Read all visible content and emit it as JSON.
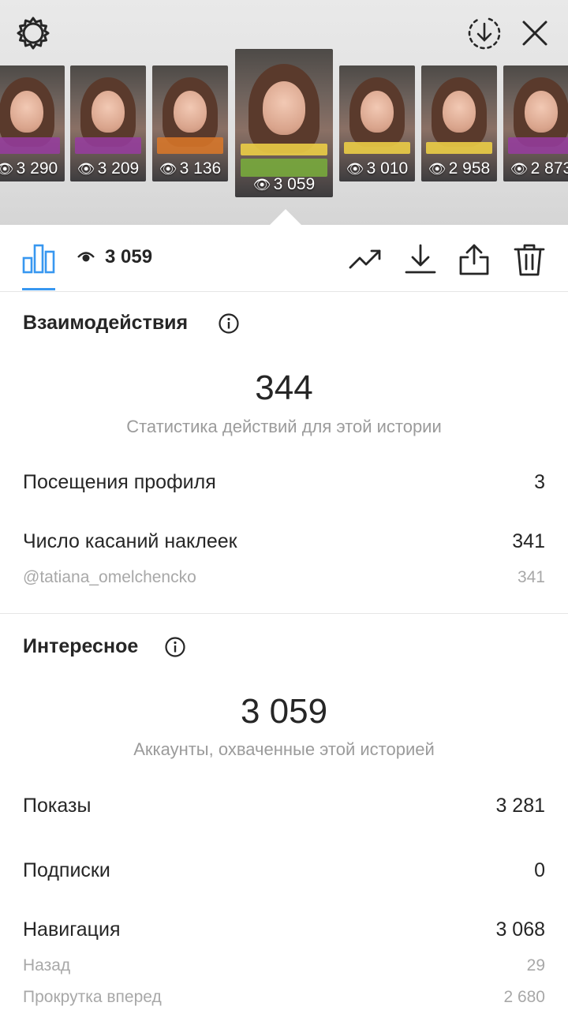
{
  "header": {
    "settings_icon": "gear-icon",
    "download_icon": "download-circle-icon",
    "close_icon": "close-icon"
  },
  "stories": [
    {
      "views": "3 290",
      "caption": "purple"
    },
    {
      "views": "3 209",
      "caption": "purple"
    },
    {
      "views": "3 136",
      "caption": "orange"
    },
    {
      "views": "3 059",
      "caption": "green",
      "selected": true,
      "tag": "@TATIANA_OMELCHENCKO"
    },
    {
      "views": "3 010",
      "caption": "yellow"
    },
    {
      "views": "2 958",
      "caption": "yellow"
    },
    {
      "views": "2 873",
      "caption": "purple"
    }
  ],
  "toolbar": {
    "views": "3 059",
    "icons": [
      "bar-chart-icon",
      "eye-icon",
      "trending-icon",
      "download-icon",
      "share-icon",
      "trash-icon"
    ],
    "accent": "#3897f0"
  },
  "interactions": {
    "title": "Взаимодействия",
    "total": "344",
    "subtitle": "Статистика действий для этой истории",
    "rows": [
      {
        "label": "Посещения профиля",
        "value": "3"
      },
      {
        "label": "Число касаний наклеек",
        "value": "341"
      },
      {
        "label": "@tatiana_omelchencko",
        "value": "341",
        "muted": true
      }
    ]
  },
  "discovery": {
    "title": "Интересное",
    "total": "3 059",
    "subtitle": "Аккаунты, охваченные этой историей",
    "rows": [
      {
        "label": "Показы",
        "value": "3 281"
      },
      {
        "label": "Подписки",
        "value": "0"
      },
      {
        "label": "Навигация",
        "value": "3 068"
      },
      {
        "label": "Назад",
        "value": "29",
        "muted": true
      },
      {
        "label": "Прокрутка вперед",
        "value": "2 680",
        "muted": true
      }
    ]
  }
}
